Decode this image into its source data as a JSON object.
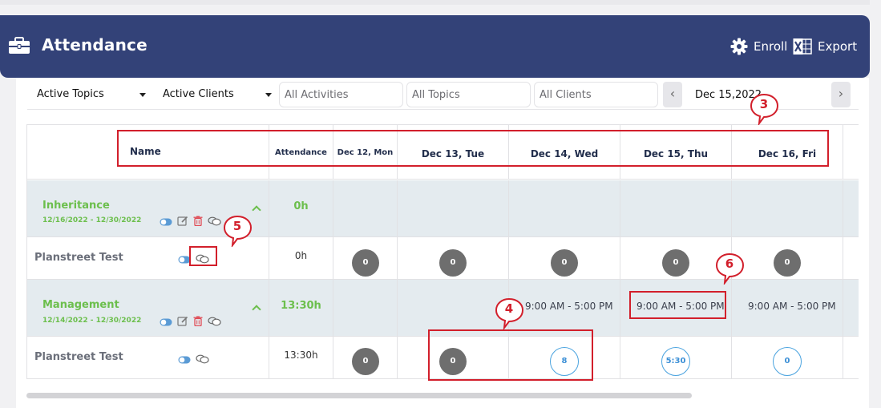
{
  "header": {
    "title": "Attendance",
    "enroll_label": "Enroll",
    "export_label": "Export"
  },
  "filters": {
    "topics_select": "Active Topics",
    "clients_select": "Active Clients",
    "activities_placeholder": "All Activities",
    "topics_placeholder": "All Topics",
    "clients_placeholder": "All Clients",
    "date_value": "Dec 15,2022",
    "prev_label": "‹",
    "next_label": "›"
  },
  "table": {
    "columns": {
      "name": "Name",
      "attendance": "Attendance",
      "day1": "Dec 12, Mon",
      "day2": "Dec 13, Tue",
      "day3": "Dec 14, Wed",
      "day4": "Dec 15, Thu",
      "day5": "Dec 16, Fri"
    },
    "groups": [
      {
        "name": "Inheritance",
        "dates": "12/16/2022 - 12/30/2022",
        "total": "0h",
        "student": {
          "name": "Planstreet Test",
          "attendance": "0h",
          "days": [
            "0",
            "0",
            "0",
            "0",
            "0"
          ]
        }
      },
      {
        "name": "Management",
        "dates": "12/14/2022 - 12/30/2022",
        "total": "13:30h",
        "schedule": {
          "day3": "9:00 AM - 5:00 PM",
          "day4": "9:00 AM - 5:00 PM",
          "day5": "9:00 AM - 5:00 PM"
        },
        "student": {
          "name": "Planstreet Test",
          "attendance": "13:30h",
          "days": [
            "0",
            "0",
            "8",
            "5:30",
            "0"
          ]
        }
      }
    ]
  },
  "annotations": {
    "n3": "3",
    "n4": "4",
    "n5": "5",
    "n6": "6"
  },
  "colors": {
    "header_bg": "#334278",
    "group_green": "#6cbf4d",
    "group_bg": "#e4ebef",
    "annotation_red": "#d21f2b",
    "ring_blue": "#4aa3df"
  }
}
